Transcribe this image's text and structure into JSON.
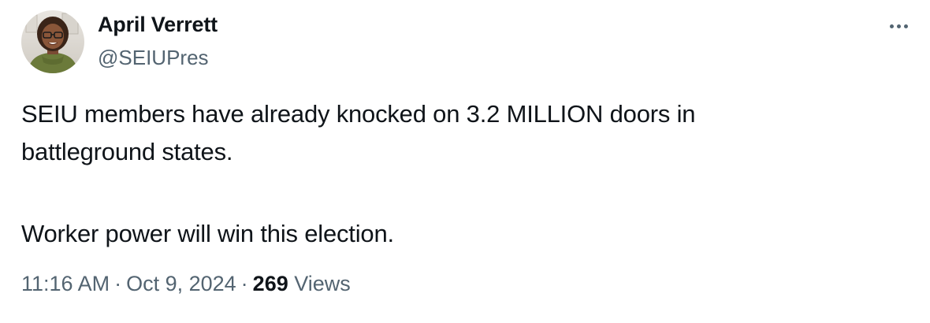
{
  "author": {
    "display_name": "April Verrett",
    "handle": "@SEIUPres",
    "avatar_icon": "user-avatar-photo"
  },
  "menu": {
    "more_icon": "more-horizontal-icon"
  },
  "tweet": {
    "line1": "SEIU members have already knocked on 3.2 MILLION doors in",
    "line2": "battleground states.",
    "line3": "Worker power will win this election."
  },
  "meta": {
    "time": "11:16 AM",
    "separator": "·",
    "date": "Oct 9, 2024",
    "views_count": "269",
    "views_label": "Views"
  },
  "colors": {
    "text_primary": "#0f1419",
    "text_secondary": "#536471",
    "background": "#ffffff"
  }
}
